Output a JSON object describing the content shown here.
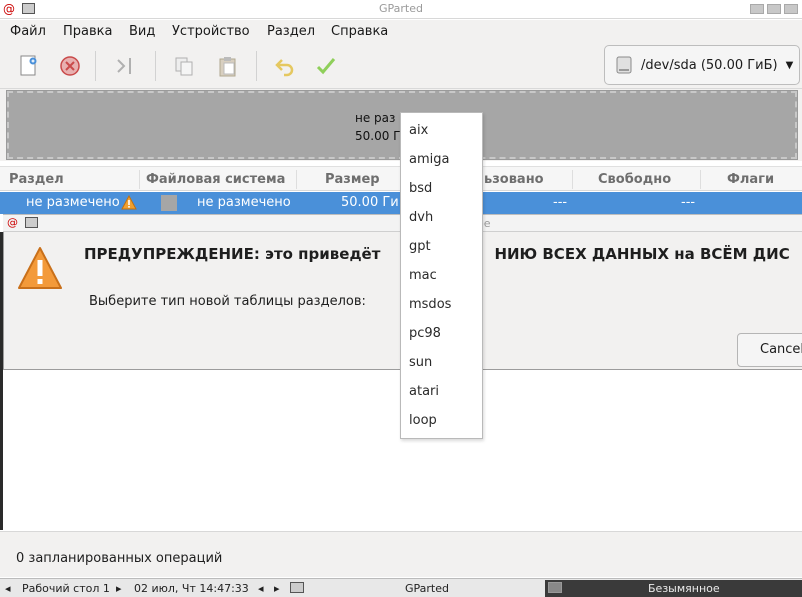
{
  "window": {
    "title": "GParted"
  },
  "menu": [
    "Файл",
    "Правка",
    "Вид",
    "Устройство",
    "Раздел",
    "Справка"
  ],
  "device": {
    "label": "/dev/sda (50.00 ГиБ)"
  },
  "disk_graphic": {
    "line1": "не раз",
    "line2": "50.00 Г"
  },
  "columns": [
    "Раздел",
    "Файловая система",
    "Размер",
    "ьзовано",
    "Свободно",
    "Флаги"
  ],
  "row": {
    "partition": "не размечено",
    "filesystem": "не размечено",
    "size": "50.00 ГиБ",
    "used": "---",
    "free": "---"
  },
  "dialog": {
    "title": "ое",
    "warning": "ПРЕДУПРЕЖДЕНИЕ: это приведёт к УНИЧТОЖЕНИЮ ВСЕХ ДАННЫХ на ВСЁМ ДИСКЕ",
    "warning_visible_left": "ПРЕДУПРЕЖДЕНИЕ: это приведёт",
    "warning_visible_right": "НИЮ ВСЕХ ДАННЫХ на ВСЁМ ДИС",
    "choose_label": "Выберите тип новой таблицы разделов:",
    "cancel": "Cancel"
  },
  "partition_table_types": [
    "aix",
    "amiga",
    "bsd",
    "dvh",
    "gpt",
    "mac",
    "msdos",
    "pc98",
    "sun",
    "atari",
    "loop"
  ],
  "status": {
    "pending": "0 запланированных операций"
  },
  "taskbar": {
    "desktop": "Рабочий стол 1",
    "clock": "02 июл, Чт 14:47:33",
    "app": "GParted",
    "other": "Безымянное"
  }
}
